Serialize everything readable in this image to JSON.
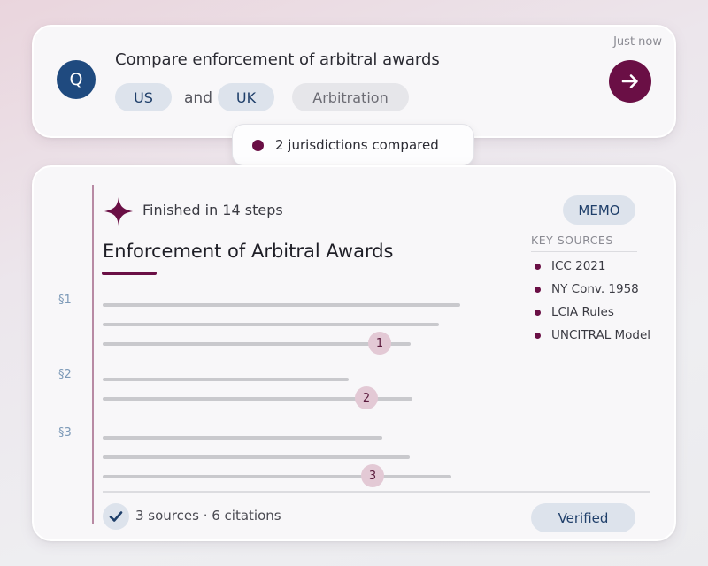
{
  "query": {
    "avatar_letter": "Q",
    "text": "Compare enforcement of arbitral awards",
    "timestamp": "Just now",
    "jurisdictions": [
      "US",
      "UK"
    ],
    "joiner": "and",
    "practice_area": "Arbitration",
    "send_icon": "arrow-right-icon"
  },
  "status": {
    "text": "2 jurisdictions compared"
  },
  "memo": {
    "steps_text": "Finished in 14 steps",
    "badge": "MEMO",
    "title": "Enforcement of Arbitral Awards",
    "sections": [
      {
        "label": "§1",
        "citation": "1"
      },
      {
        "label": "§2",
        "citation": "2"
      },
      {
        "label": "§3",
        "citation": "3"
      }
    ],
    "key_sources": {
      "heading": "KEY SOURCES",
      "items": [
        "ICC 2021",
        "NY Conv. 1958",
        "LCIA Rules",
        "UNCITRAL Model"
      ]
    },
    "footer": {
      "summary": "3 sources · 6 citations",
      "verified_label": "Verified"
    }
  },
  "colors": {
    "accent": "#6a0f45",
    "avatar": "#1f4a7f",
    "chip_bg": "#dde3ec",
    "chip_text": "#1f3f6a"
  }
}
